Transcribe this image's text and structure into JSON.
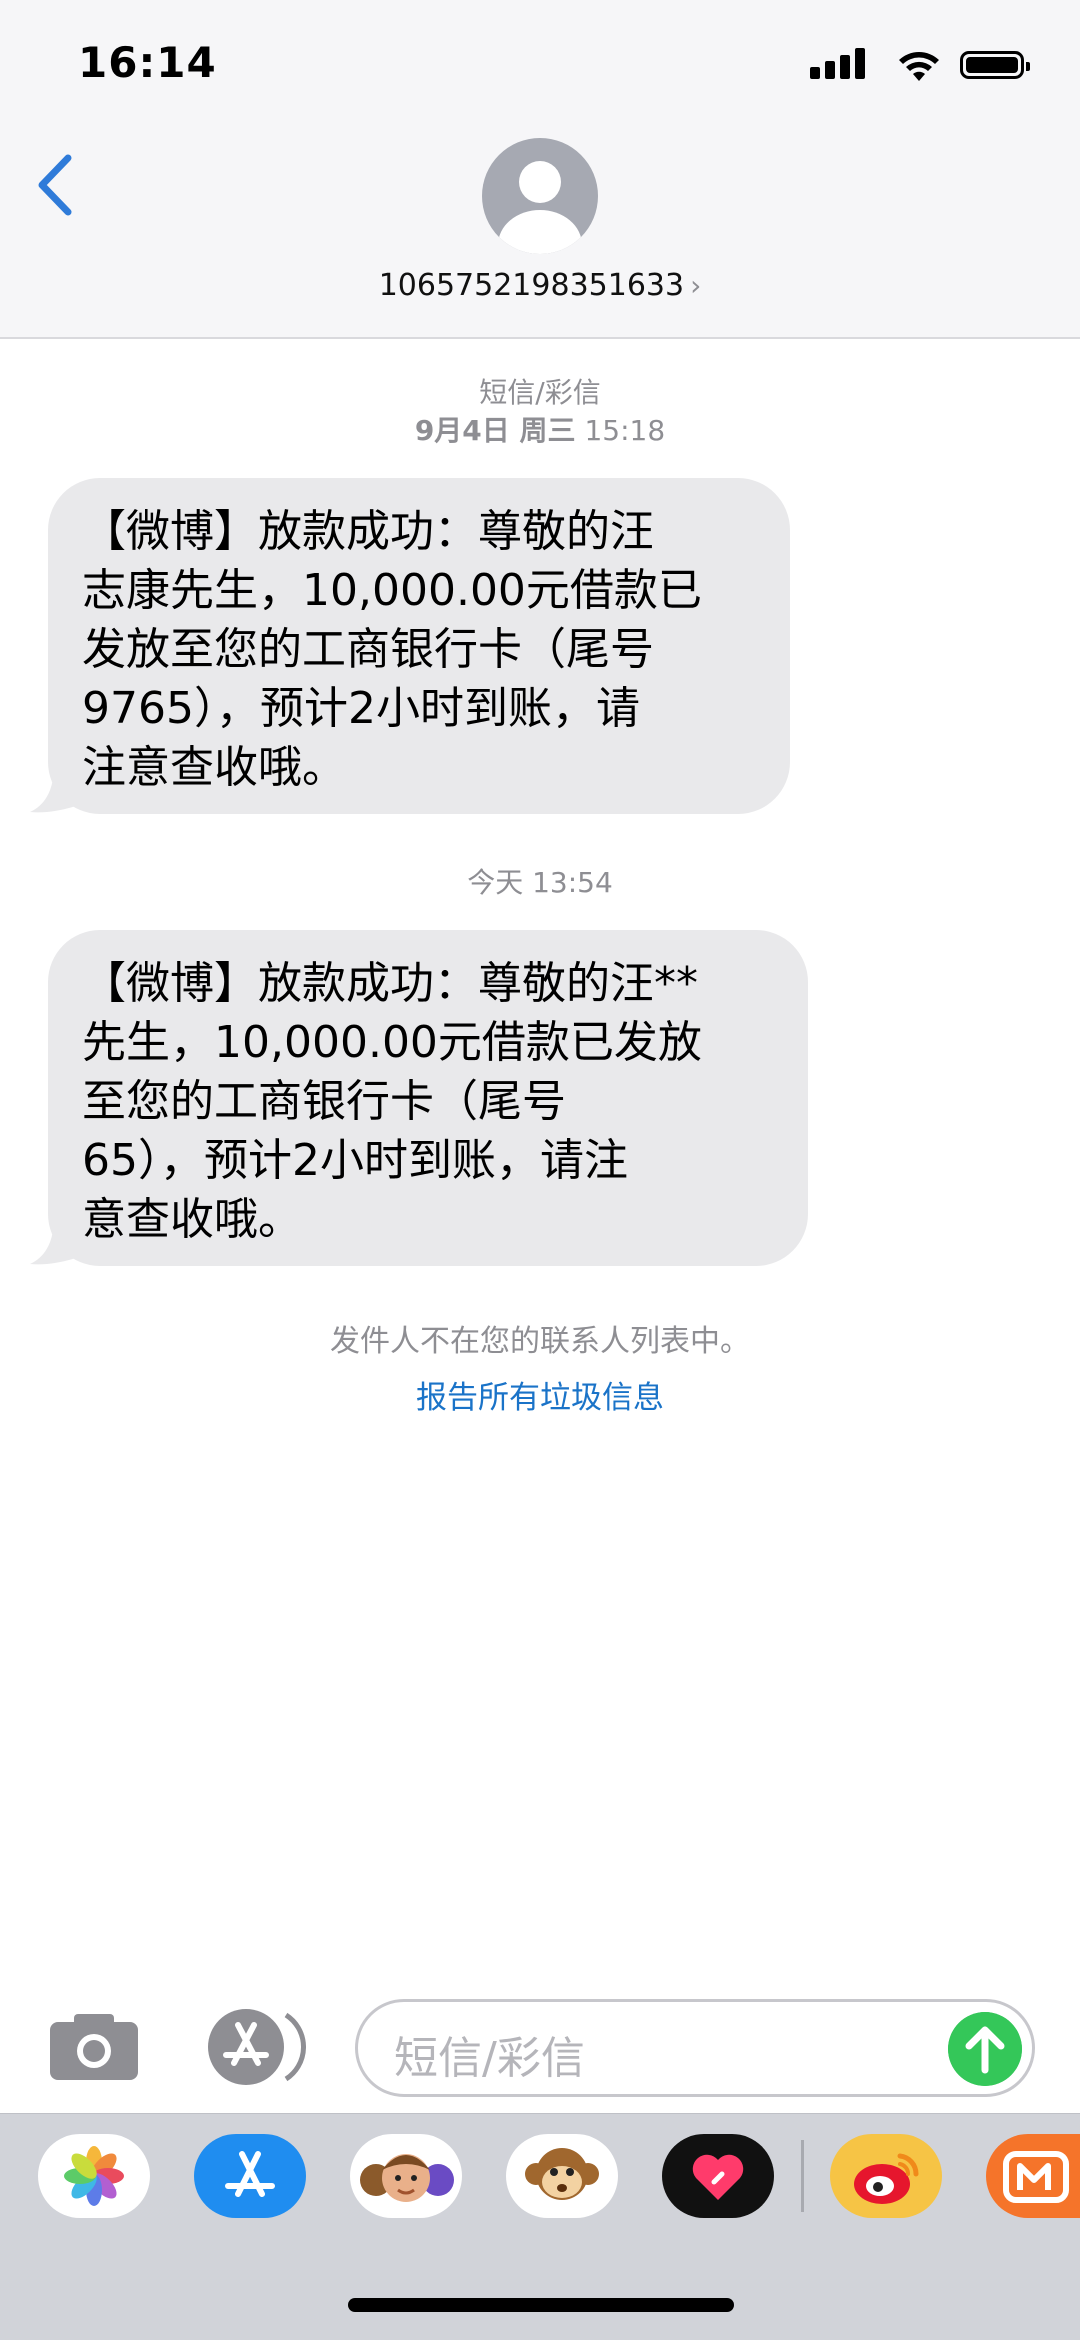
{
  "status_bar": {
    "time": "16:14"
  },
  "header": {
    "back_icon": "chevron-left-icon",
    "avatar_icon": "person-icon",
    "contact": "1065752198351633",
    "contact_chevron": "›"
  },
  "messages": [
    {
      "service": "短信/彩信",
      "date": "9月4日 周三",
      "time": "15:18",
      "text": "【微博】放款成功：尊敬的汪\n志康先生，10,000.00元借款已\n发放至您的工商银行卡（尾号\n9765），预计2小时到账，请\n注意查收哦。"
    },
    {
      "date": "今天",
      "time": "13:54",
      "text": "【微博】放款成功：尊敬的汪**\n先生，10,000.00元借款已发放\n至您的工商银行卡（尾号\n65），预计2小时到账，请注\n意查收哦。"
    }
  ],
  "notice": "发件人不在您的联系人列表中。",
  "report_link": "报告所有垃圾信息",
  "compose": {
    "placeholder": "短信/彩信",
    "camera_icon": "camera-icon",
    "apps_icon": "app-store-icon",
    "send_icon": "arrow-up-icon"
  },
  "app_drawer": [
    "photos-icon",
    "app-store-icon",
    "memoji-icon",
    "animoji-monkey-icon",
    "digital-touch-icon",
    "weibo-icon",
    "mango-tv-icon"
  ],
  "colors": {
    "accent": "#1a73c8",
    "bubble": "#e9e9eb",
    "send": "#34c759",
    "secondary_text": "#8e8e93"
  }
}
